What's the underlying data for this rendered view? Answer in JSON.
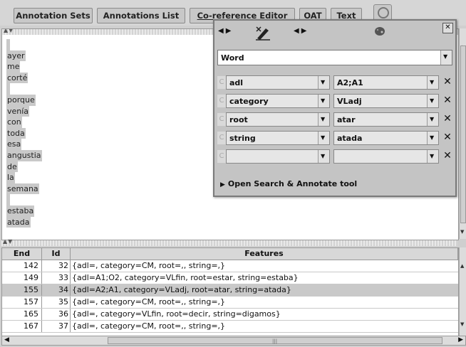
{
  "toolbar": {
    "buttons": [
      "Annotation Sets",
      "Annotations List",
      "Co-reference Editor",
      "OAT",
      "Text"
    ]
  },
  "text_words": [
    "",
    "ayer",
    "me",
    "corté",
    "",
    "porque",
    "venía",
    "con",
    "toda",
    "esa",
    "angustia",
    "de",
    "la",
    "semana",
    "",
    "estaba",
    "atada"
  ],
  "editor": {
    "type": "Word",
    "features": [
      {
        "name": "adl",
        "value": "A2;A1"
      },
      {
        "name": "category",
        "value": "VLadj"
      },
      {
        "name": "root",
        "value": "atar"
      },
      {
        "name": "string",
        "value": "atada"
      },
      {
        "name": "",
        "value": ""
      }
    ],
    "search_label": "Open Search & Annotate tool",
    "dot_glyph": "C"
  },
  "table": {
    "headers": [
      "End",
      "Id",
      "Features"
    ],
    "rows": [
      {
        "end": "142",
        "id": "32",
        "features": "{adl=, category=CM, root=,, string=,}"
      },
      {
        "end": "149",
        "id": "33",
        "features": "{adl=A1;O2, category=VLfin, root=estar, string=estaba}"
      },
      {
        "end": "155",
        "id": "34",
        "features": "{adl=A2;A1, category=VLadj, root=atar, string=atada}"
      },
      {
        "end": "157",
        "id": "35",
        "features": "{adl=, category=CM, root=,, string=,}"
      },
      {
        "end": "165",
        "id": "36",
        "features": "{adl=, category=VLfin, root=decir, string=digamos}"
      },
      {
        "end": "167",
        "id": "37",
        "features": "{adl=, category=CM, root=,, string=,}"
      }
    ],
    "selected_row": 2
  },
  "colors": {
    "highlight": "#c9c9c9",
    "panel": "#c4c4c4",
    "background": "#cfcfcf"
  },
  "icons": [
    "search-icon",
    "pen-icon",
    "palette-icon",
    "close-icon",
    "chevron-down-icon",
    "delete-icon"
  ]
}
